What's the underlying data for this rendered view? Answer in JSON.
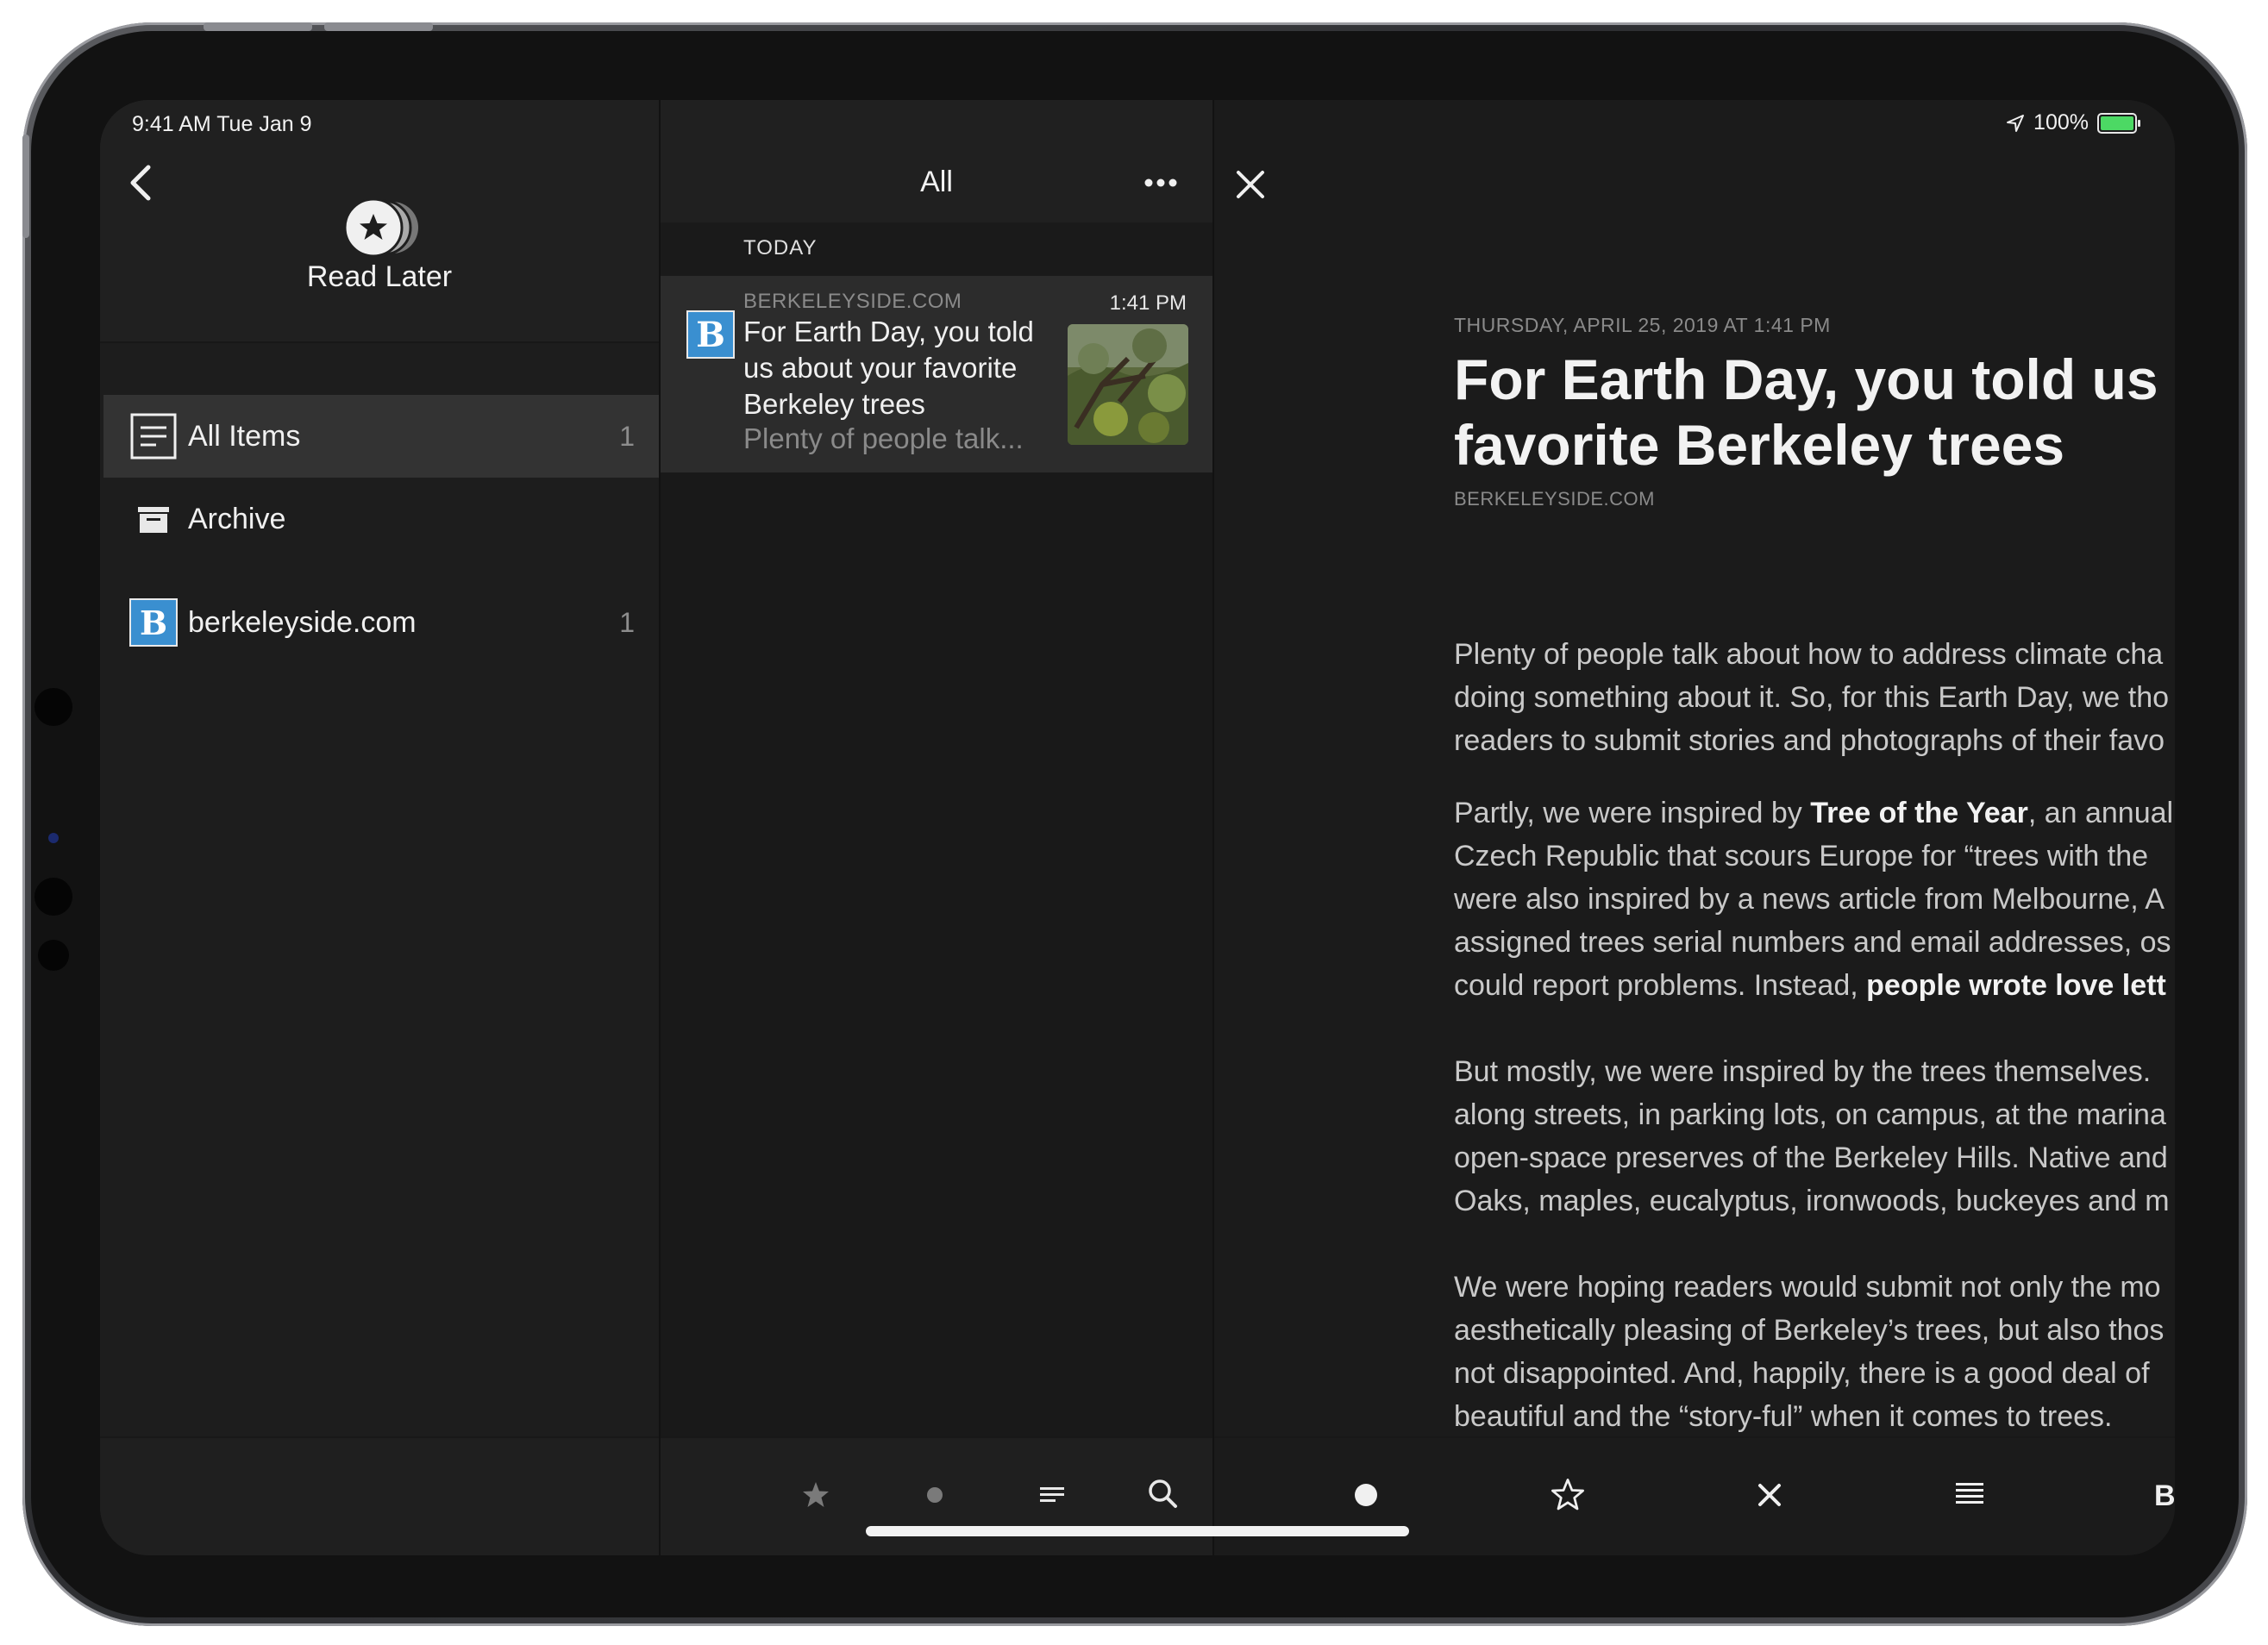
{
  "status_bar": {
    "time": "9:41 AM   Tue Jan 9",
    "battery": "100%"
  },
  "sidebar": {
    "title": "Read Later",
    "items": [
      {
        "label": "All Items",
        "count": "1"
      },
      {
        "label": "Archive",
        "count": ""
      },
      {
        "label": "berkeleyside.com",
        "count": "1"
      }
    ]
  },
  "list": {
    "title": "All",
    "section": "TODAY",
    "article": {
      "source": "BERKELEYSIDE.COM",
      "time": "1:41 PM",
      "title": "For Earth Day, you told us about your favorite Berkeley trees",
      "snippet": "Plenty of people talk..."
    }
  },
  "reader": {
    "date": "THURSDAY, APRIL 25, 2019 AT 1:41 PM",
    "title_line1": "For Earth Day, you told us a",
    "title_line2": "favorite Berkeley trees",
    "source": "BERKELEYSIDE.COM",
    "paragraphs": [
      [
        "Plenty of people talk about how to address climate cha",
        "doing something about it. So, for this Earth Day, we tho",
        "readers to submit stories and photographs of their favo"
      ],
      [
        "Czech Republic that scours Europe for “trees with the",
        "were also inspired by a news article from Melbourne, A",
        "assigned trees serial numbers and email addresses, os"
      ],
      [
        "But mostly, we were inspired by the trees themselves.",
        "along streets, in parking lots, on campus, at the marina",
        "open-space preserves of the Berkeley Hills. Native and",
        "Oaks, maples, eucalyptus, ironwoods, buckeyes and m"
      ],
      [
        "We were hoping readers would submit not only the mo",
        "aesthetically pleasing of Berkeley’s trees, but also thos",
        "not disappointed. And, happily, there is a good deal of",
        "beautiful and the “story-ful” when it comes to trees."
      ]
    ],
    "p2_line1_pre": "Partly, we were inspired by ",
    "p2_line1_bold": "Tree of the Year",
    "p2_line1_post": ", an annual",
    "p2_line5_pre": "could report problems. Instead, ",
    "p2_line5_bold": "people wrote love lett"
  },
  "toolbar_letter": "B",
  "icons": {
    "back": "chevron-left-icon",
    "read_later": "star-circle-icon",
    "all_items": "document-list-icon",
    "archive": "archive-box-icon",
    "more": "ellipsis-icon",
    "close": "close-icon",
    "list_toolbar": [
      "star-icon",
      "dot-icon",
      "filter-lines-icon",
      "search-icon"
    ],
    "reader_toolbar": [
      "unread-dot-icon",
      "star-outline-icon",
      "close-icon",
      "text-lines-icon",
      "text-style-icon"
    ]
  },
  "colors": {
    "favicon_blue": "#3a8fd0",
    "battery_green": "#4cd964",
    "selected_row": "#333333"
  }
}
